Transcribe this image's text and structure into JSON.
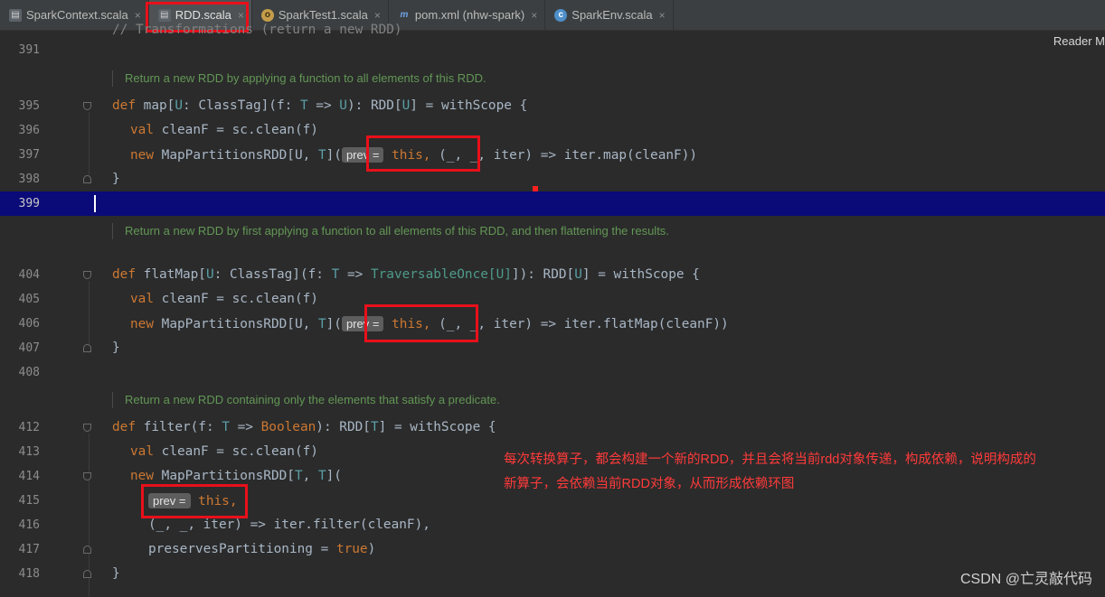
{
  "tabs": [
    {
      "label": "SparkContext.scala",
      "icon": "scala-file-icon",
      "active": false
    },
    {
      "label": "RDD.scala",
      "icon": "scala-file-icon",
      "active": true
    },
    {
      "label": "SparkTest1.scala",
      "icon": "object-file-icon",
      "active": false
    },
    {
      "label": "pom.xml (nhw-spark)",
      "icon": "maven-icon",
      "active": false
    },
    {
      "label": "SparkEnv.scala",
      "icon": "class-file-icon",
      "active": false
    }
  ],
  "tab_close_glyph": "×",
  "reader_mode": "Reader M",
  "lines": {
    "l391": "391",
    "l395": "395",
    "l396": "396",
    "l397": "397",
    "l398": "398",
    "l399": "399",
    "l404": "404",
    "l405": "405",
    "l406": "406",
    "l407": "407",
    "l408": "408",
    "l412": "412",
    "l413": "413",
    "l414": "414",
    "l415": "415",
    "l416": "416",
    "l417": "417",
    "l418": "418"
  },
  "docs": {
    "map": "Return a new RDD by applying a function to all elements of this RDD.",
    "flatMap": "Return a new RDD by first applying a function to all elements of this RDD, and then flattening the results.",
    "filter": "Return a new RDD containing only the elements that satisfy a predicate."
  },
  "code": {
    "c395": {
      "k": "def",
      "name": " map[",
      "t1": "U",
      "p1": ": ClassTag](f: ",
      "t2": "T",
      "p2": " => ",
      "t3": "U",
      "p3": "): RDD[",
      "t4": "U",
      "p4": "] = withScope {"
    },
    "c396": {
      "k": "val",
      "rest": " cleanF = sc.clean(f)"
    },
    "c397": {
      "k": "new",
      "a": " MapPartitionsRDD[U, ",
      "t": "T",
      "b": "](",
      "hint": "prev =",
      "this": "this,",
      "c": " (_, _, iter) => iter.map(cleanF))"
    },
    "c398": "}",
    "c404": {
      "k": "def",
      "name": " flatMap[",
      "t1": "U",
      "p1": ": ClassTag](f: ",
      "t2": "T",
      "p2": " => ",
      "t3": "TraversableOnce[U]",
      "p3": "]): RDD[",
      "t4": "U",
      "p4": "] = withScope {"
    },
    "c405": {
      "k": "val",
      "rest": " cleanF = sc.clean(f)"
    },
    "c406": {
      "k": "new",
      "a": " MapPartitionsRDD[U, ",
      "t": "T",
      "b": "](",
      "hint": "prev =",
      "this": "this,",
      "c": " (_, _, iter) => iter.flatMap(cleanF))"
    },
    "c407": "}",
    "c412": {
      "k": "def",
      "name": " filter(f: ",
      "t1": "T",
      "p1": " => ",
      "b": "Boolean",
      "p2": "): RDD[",
      "t2": "T",
      "p3": "] = withScope {"
    },
    "c413": {
      "k": "val",
      "rest": " cleanF = sc.clean(f)"
    },
    "c414": {
      "k": "new",
      "a": " MapPartitionsRDD[",
      "t1": "T",
      "m": ", ",
      "t2": "T",
      "b": "]("
    },
    "c415": {
      "hint": "prev =",
      "this": "this,"
    },
    "c416": "(_, _, iter) => iter.filter(cleanF),",
    "c417": {
      "a": "preservesPartitioning = ",
      "v": "true",
      "b": ")"
    },
    "c418": "}"
  },
  "annotation": "每次转换算子，都会构建一个新的RDD，并且会将当前rdd对象传递，构成依赖，说明构成的新算子，会依赖当前RDD对象，从而形成依赖环图",
  "watermark": "CSDN @亡灵敲代码",
  "colors": {
    "accent_box": "#e8101a",
    "current_line": "#0a0a78",
    "doc_text": "#629755",
    "keyword": "#cc7832"
  }
}
